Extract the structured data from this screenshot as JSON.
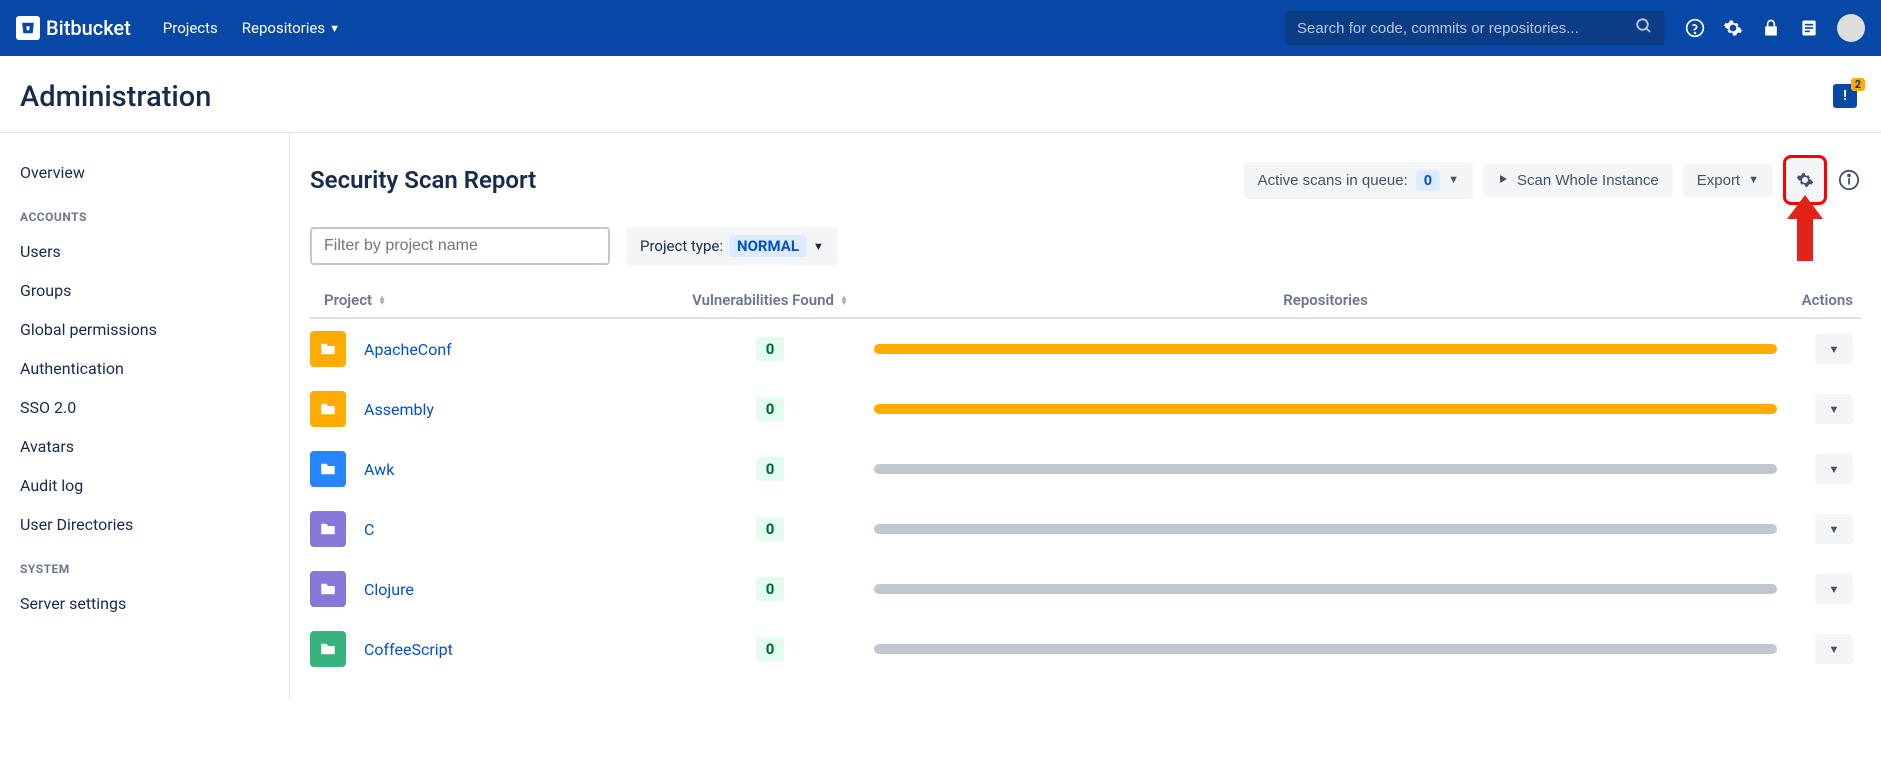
{
  "app": {
    "name": "Bitbucket"
  },
  "nav": {
    "projects": "Projects",
    "repositories": "Repositories"
  },
  "search": {
    "placeholder": "Search for code, commits or repositories..."
  },
  "pageTitle": "Administration",
  "notificationCount": "2",
  "sidebar": {
    "overview": "Overview",
    "accountsHeading": "ACCOUNTS",
    "users": "Users",
    "groups": "Groups",
    "globalPermissions": "Global permissions",
    "authentication": "Authentication",
    "sso": "SSO 2.0",
    "avatars": "Avatars",
    "auditLog": "Audit log",
    "userDirectories": "User Directories",
    "systemHeading": "SYSTEM",
    "serverSettings": "Server settings"
  },
  "report": {
    "title": "Security Scan Report",
    "activeScansLabel": "Active scans in queue:",
    "activeScansValue": "0",
    "scanWhole": "Scan Whole Instance",
    "export": "Export",
    "filterPlaceholder": "Filter by project name",
    "projectTypeLabel": "Project type:",
    "projectTypeValue": "NORMAL",
    "columns": {
      "project": "Project",
      "vuln": "Vulnerabilities Found",
      "repos": "Repositories",
      "actions": "Actions"
    }
  },
  "projects": [
    {
      "name": "ApacheConf",
      "vuln": "0",
      "color": "#FFAB00",
      "bar": "#FFAB00"
    },
    {
      "name": "Assembly",
      "vuln": "0",
      "color": "#FFAB00",
      "bar": "#FFAB00"
    },
    {
      "name": "Awk",
      "vuln": "0",
      "color": "#2684FF",
      "bar": "#C1C7D0"
    },
    {
      "name": "C",
      "vuln": "0",
      "color": "#8777D9",
      "bar": "#C1C7D0"
    },
    {
      "name": "Clojure",
      "vuln": "0",
      "color": "#8777D9",
      "bar": "#C1C7D0"
    },
    {
      "name": "CoffeeScript",
      "vuln": "0",
      "color": "#36B37E",
      "bar": "#C1C7D0"
    }
  ]
}
